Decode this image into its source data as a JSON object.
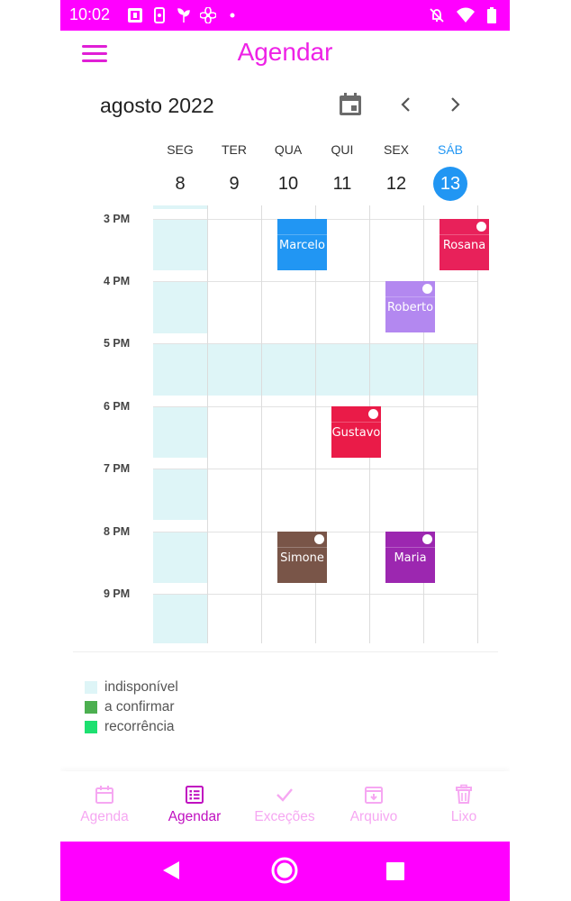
{
  "status_bar": {
    "time": "10:02",
    "bg_color": "#ff00ff"
  },
  "header": {
    "title": "Agendar",
    "title_color": "#ee22e6",
    "menu_icon": "hamburger-menu-icon"
  },
  "calendar": {
    "month": "agosto 2022",
    "today_color": "#2196f3",
    "days": [
      {
        "dow": "SEG",
        "num": "8"
      },
      {
        "dow": "TER",
        "num": "9"
      },
      {
        "dow": "QUA",
        "num": "10"
      },
      {
        "dow": "QUI",
        "num": "11"
      },
      {
        "dow": "SEX",
        "num": "12"
      },
      {
        "dow": "SÁB",
        "num": "13",
        "today": true
      }
    ],
    "hours": [
      "3 PM",
      "4 PM",
      "5 PM",
      "6 PM",
      "7 PM",
      "8 PM",
      "9 PM"
    ],
    "events": [
      {
        "name": "Marcelo",
        "day": 2,
        "hour": 0,
        "color": "#2196f3",
        "dot": false
      },
      {
        "name": "Rosana",
        "day": 5,
        "hour": 0,
        "color": "#e8215a",
        "dot": true
      },
      {
        "name": "Roberto",
        "day": 4,
        "hour": 1,
        "color": "#b388f0",
        "dot": true
      },
      {
        "name": "Gustavo",
        "day": 3,
        "hour": 3,
        "color": "#ea1b48",
        "dot": true
      },
      {
        "name": "Simone",
        "day": 2,
        "hour": 5,
        "color": "#795548",
        "dot": true
      },
      {
        "name": "Maria",
        "day": 4,
        "hour": 5,
        "color": "#9c27b0",
        "dot": true
      }
    ]
  },
  "legend": [
    {
      "label": "indisponível",
      "color": "#def5f7"
    },
    {
      "label": "a confirmar",
      "color": "#4caf50"
    },
    {
      "label": "recorrência",
      "color": "#1de070"
    }
  ],
  "bottom_nav": [
    {
      "label": "Agenda",
      "icon": "calendar-icon"
    },
    {
      "label": "Agendar",
      "icon": "list-icon",
      "active": true
    },
    {
      "label": "Exceções",
      "icon": "check-icon"
    },
    {
      "label": "Arquivo",
      "icon": "archive-icon"
    },
    {
      "label": "Lixo",
      "icon": "trash-icon"
    }
  ]
}
